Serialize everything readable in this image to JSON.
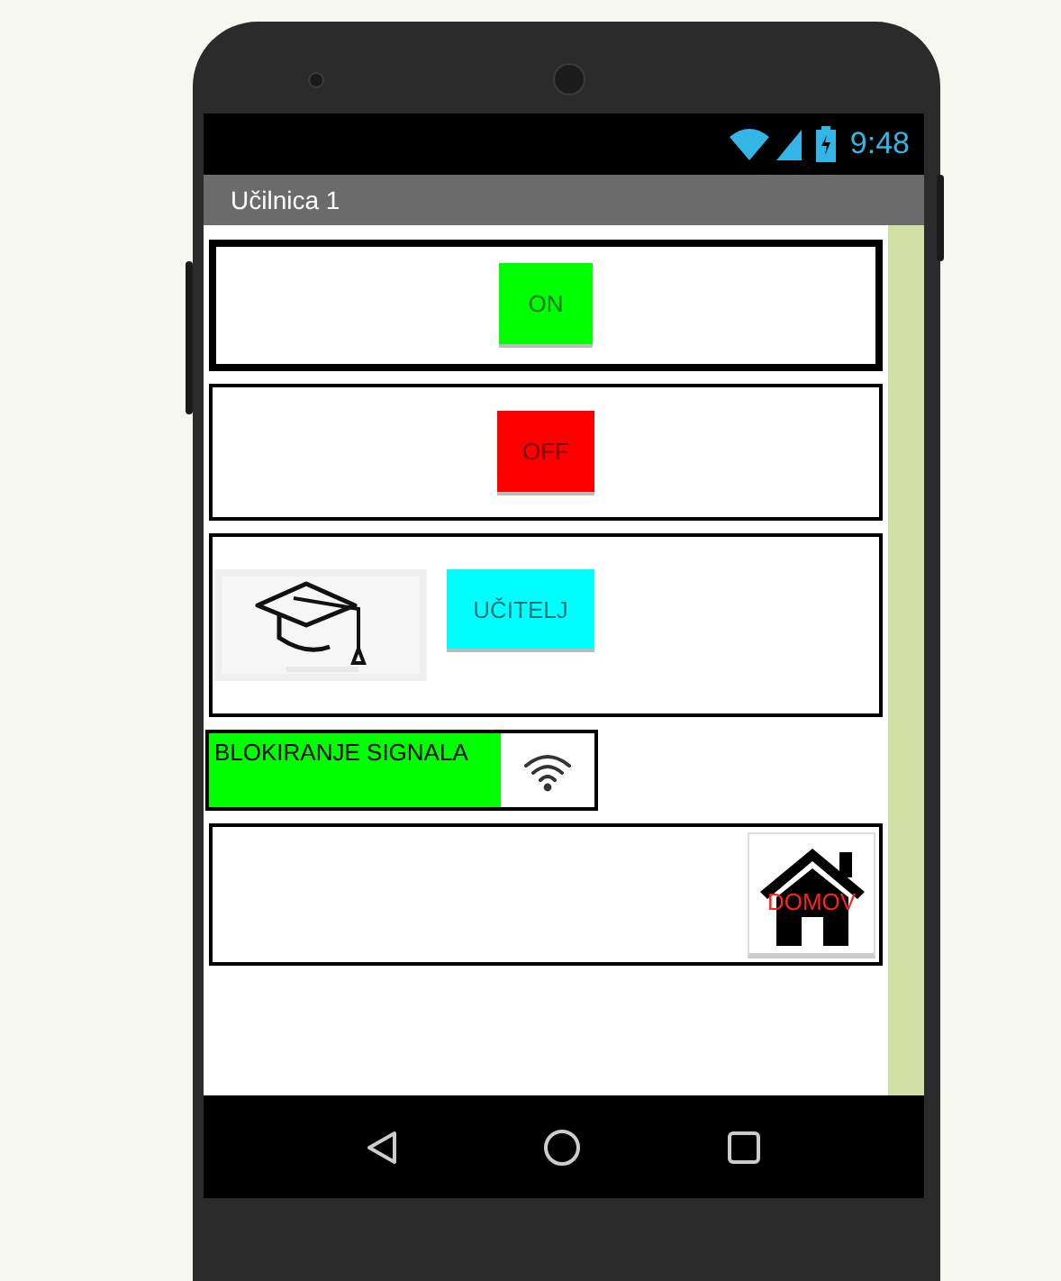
{
  "status_bar": {
    "time": "9:48"
  },
  "title_bar": {
    "title": "Učilnica 1"
  },
  "blocks": [
    {
      "kind": "button",
      "label": "ON",
      "color": "#00ff00",
      "thick": true
    },
    {
      "kind": "button",
      "label": "OFF",
      "color": "#ff0000",
      "thick": false
    },
    {
      "kind": "teacher",
      "label": "UČITELJ",
      "color": "#00ffff",
      "thick": false
    },
    {
      "kind": "signal",
      "label": "BLOKIRANJE SIGNALA",
      "color": "#00ff00",
      "thick": false
    },
    {
      "kind": "home",
      "label": "DOMOV",
      "color": "#ffffff",
      "thick": false
    }
  ]
}
